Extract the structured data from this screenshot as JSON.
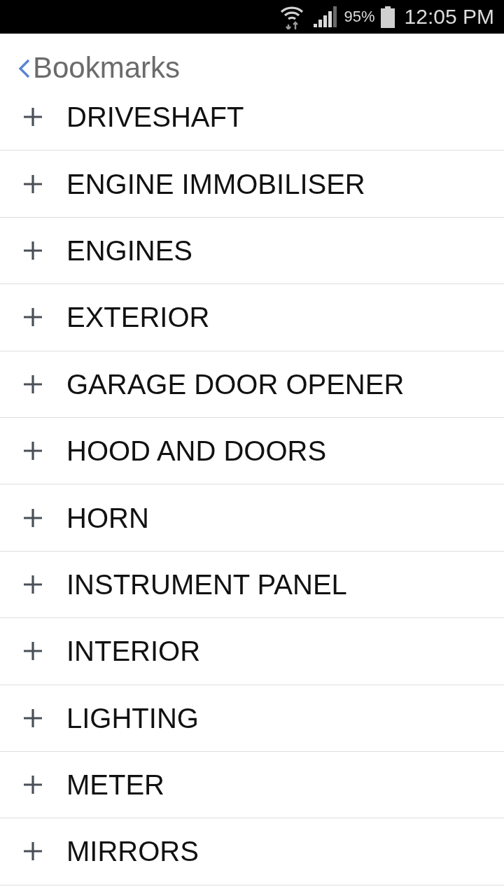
{
  "status_bar": {
    "battery": "95%",
    "time": "12:05 PM"
  },
  "header": {
    "back_label": "Bookmarks"
  },
  "items": [
    {
      "label": "DRIVESHAFT",
      "expanded": false
    },
    {
      "label": "ENGINE IMMOBILISER",
      "expanded": false
    },
    {
      "label": "ENGINES",
      "expanded": false
    },
    {
      "label": "EXTERIOR",
      "expanded": false
    },
    {
      "label": "GARAGE DOOR OPENER",
      "expanded": false
    },
    {
      "label": "HOOD AND DOORS",
      "expanded": false
    },
    {
      "label": "HORN",
      "expanded": false
    },
    {
      "label": "INSTRUMENT PANEL",
      "expanded": false
    },
    {
      "label": "INTERIOR",
      "expanded": false
    },
    {
      "label": "LIGHTING",
      "expanded": false
    },
    {
      "label": "METER",
      "expanded": false
    },
    {
      "label": "MIRRORS",
      "expanded": false
    }
  ]
}
